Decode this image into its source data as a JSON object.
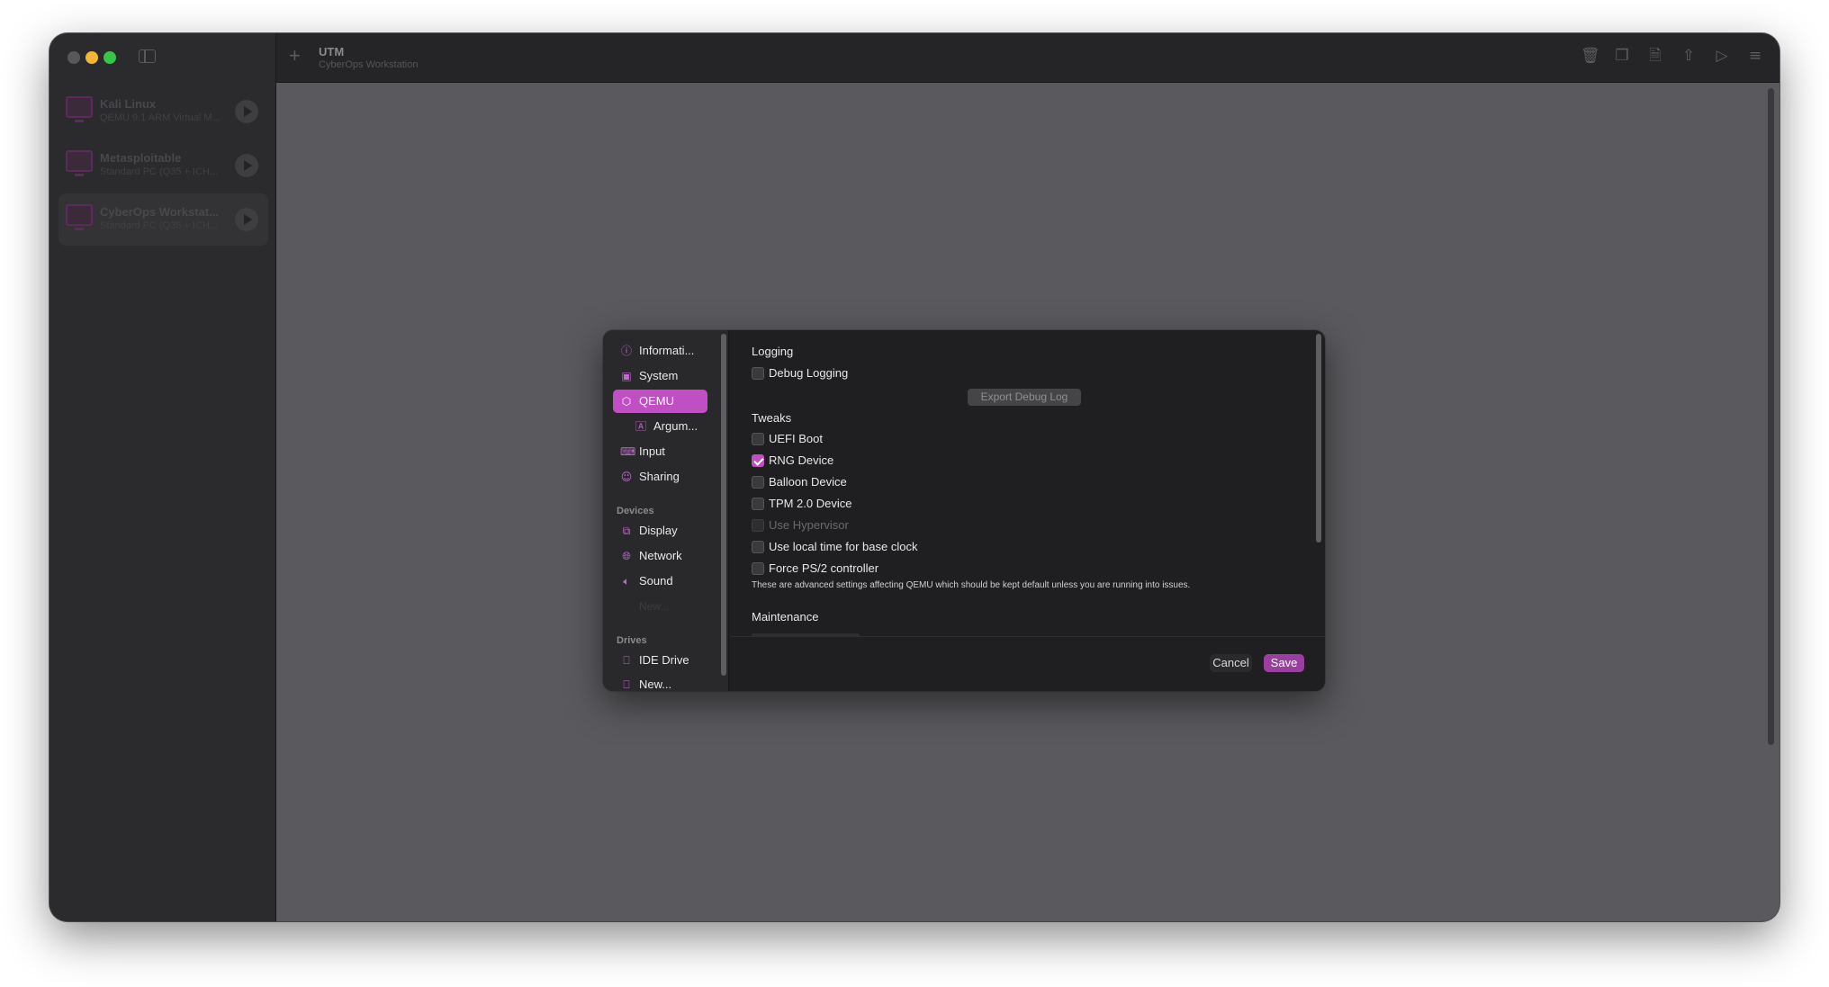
{
  "app": {
    "title": "UTM",
    "subtitle": "CyberOps Workstation"
  },
  "vm_list": [
    {
      "name": "Kali Linux",
      "subtitle": "QEMU 9.1 ARM Virtual M..."
    },
    {
      "name": "Metasploitable",
      "subtitle": "Standard PC (Q35 + ICH..."
    },
    {
      "name": "CyberOps Workstat...",
      "subtitle": "Standard PC (Q35 + ICH..."
    }
  ],
  "toolbar_icons": [
    "trash-icon",
    "clone-icon",
    "document-icon",
    "share-icon",
    "play-icon",
    "settings-icon"
  ],
  "settings": {
    "nav": {
      "information": "Informati...",
      "system": "System",
      "qemu": "QEMU",
      "arguments": "Argum...",
      "input": "Input",
      "sharing": "Sharing",
      "devices_header": "Devices",
      "display": "Display",
      "network": "Network",
      "sound": "Sound",
      "new_device_ghost": "New...",
      "drives_header": "Drives",
      "ide_drive": "IDE Drive",
      "new_drive": "New..."
    },
    "logging": {
      "title": "Logging",
      "debug_logging": "Debug Logging",
      "export_button": "Export Debug Log"
    },
    "tweaks": {
      "title": "Tweaks",
      "uefi_boot": "UEFI Boot",
      "rng_device": "RNG Device",
      "balloon_device": "Balloon Device",
      "tpm_device": "TPM 2.0 Device",
      "use_hypervisor": "Use Hypervisor",
      "local_time": "Use local time for base clock",
      "force_ps2": "Force PS/2 controller",
      "hint": "These are advanced settings affecting QEMU which should be kept default unless you are running into issues."
    },
    "checked": {
      "debug_logging": false,
      "uefi_boot": false,
      "rng_device": true,
      "balloon_device": false,
      "tpm_device": false,
      "use_hypervisor": false,
      "local_time": false,
      "force_ps2": false
    },
    "maintenance": {
      "title": "Maintenance"
    },
    "buttons": {
      "cancel": "Cancel",
      "save": "Save"
    }
  },
  "colors": {
    "accent": "#c04fc4",
    "save_button": "#9a3fa0",
    "window_bg": "#252527",
    "content_bg": "#5a5a5e"
  }
}
